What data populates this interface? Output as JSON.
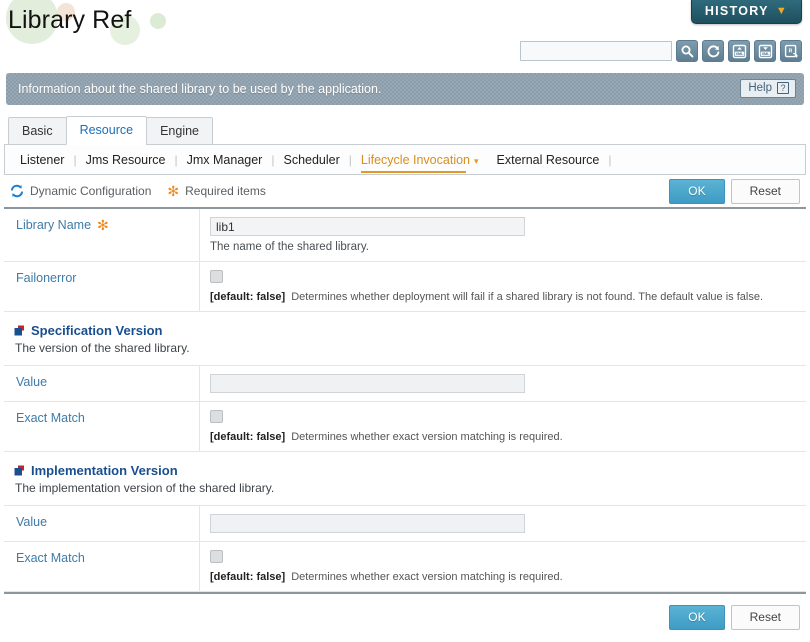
{
  "header": {
    "title": "Library Ref",
    "history_label": "HISTORY",
    "history_caret": "▼"
  },
  "toolbar": {
    "search_value": "",
    "search_placeholder": "",
    "buttons": [
      {
        "name": "search-icon",
        "title": "Search"
      },
      {
        "name": "refresh-icon",
        "title": "Refresh"
      },
      {
        "name": "xml-import-icon",
        "title": "Import XML"
      },
      {
        "name": "xml-export-icon",
        "title": "Export XML"
      },
      {
        "name": "restore-icon",
        "title": "Restore"
      }
    ]
  },
  "banner": {
    "text": "Information about the shared library to be used by the application.",
    "help_label": "Help",
    "help_icon": "?"
  },
  "tabs": [
    {
      "label": "Basic",
      "active": false
    },
    {
      "label": "Resource",
      "active": true
    },
    {
      "label": "Engine",
      "active": false
    }
  ],
  "subtabs": [
    {
      "label": "Listener",
      "active": false
    },
    {
      "label": "Jms Resource",
      "active": false
    },
    {
      "label": "Jmx Manager",
      "active": false
    },
    {
      "label": "Scheduler",
      "active": false
    },
    {
      "label": "Lifecycle Invocation",
      "active": true,
      "caret": "▾"
    },
    {
      "label": "External Resource",
      "active": false
    }
  ],
  "actionbar": {
    "dynamic_config_label": "Dynamic Configuration",
    "required_items_label": "Required items",
    "required_icon": "✻",
    "ok_label": "OK",
    "reset_label": "Reset"
  },
  "form": {
    "library_name": {
      "label": "Library Name",
      "required_icon": "✻",
      "value": "lib1",
      "hint": "The name of the shared library."
    },
    "failonerror": {
      "label": "Failonerror",
      "checked": false,
      "default_text": "[default: false]",
      "hint": "Determines whether deployment will fail if a shared library is not found. The default value is false."
    },
    "specification_version": {
      "title": "Specification Version",
      "description": "The version of the shared library.",
      "value_label": "Value",
      "value": "",
      "exact_match_label": "Exact Match",
      "exact_match_checked": false,
      "exact_match_default": "[default: false]",
      "exact_match_hint": "Determines whether exact version matching is required."
    },
    "implementation_version": {
      "title": "Implementation Version",
      "description": "The implementation version of the shared library.",
      "value_label": "Value",
      "value": "",
      "exact_match_label": "Exact Match",
      "exact_match_checked": false,
      "exact_match_default": "[default: false]",
      "exact_match_hint": "Determines whether exact version matching is required."
    }
  },
  "footer": {
    "ok_label": "OK",
    "reset_label": "Reset"
  },
  "colors": {
    "accent_blue": "#3d7ba8",
    "section_blue": "#1a4f8f",
    "orange": "#e09a2a",
    "ok_button": "#4ba6cd",
    "banner_bg": "#8c9dab",
    "history_bg": "#2f6b7c"
  }
}
